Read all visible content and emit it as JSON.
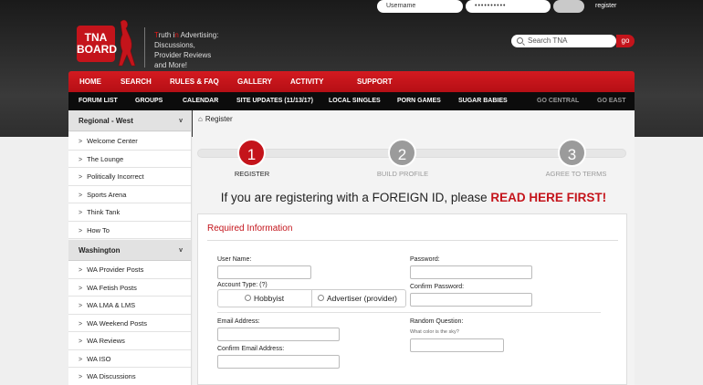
{
  "login": {
    "username_placeholder": "Username",
    "password_value": "••••••••••",
    "register_label": "register"
  },
  "logo": {
    "line1": "TNA",
    "line2": "BOARD"
  },
  "tagline": {
    "t1": "T",
    "t2": "ruth i",
    "t3": "n",
    "t4": " A",
    "t5": "dvertising:",
    "line2": "Discussions,",
    "line3": "Provider Reviews",
    "line4": "and More!"
  },
  "search": {
    "placeholder": "Search TNA",
    "go_label": "go"
  },
  "main_nav": [
    "HOME",
    "SEARCH",
    "RULES & FAQ",
    "GALLERY",
    "ACTIVITY",
    "SUPPORT"
  ],
  "sub_nav": [
    "FORUM LIST",
    "GROUPS",
    "CALENDAR",
    "SITE UPDATES (11/13/17)",
    "LOCAL SINGLES",
    "PORN GAMES",
    "SUGAR BABIES",
    "GO CENTRAL",
    "GO EAST"
  ],
  "sidebar": {
    "section1": {
      "title": "Regional - West",
      "items": [
        "Welcome Center",
        "The Lounge",
        "Politically Incorrect",
        "Sports Arena",
        "Think Tank",
        "How To"
      ]
    },
    "section2": {
      "title": "Washington",
      "items": [
        "WA Provider Posts",
        "WA Fetish Posts",
        "WA LMA & LMS",
        "WA Weekend Posts",
        "WA Reviews",
        "WA ISO",
        "WA Discussions"
      ]
    }
  },
  "breadcrumb": "Register",
  "steps": [
    {
      "num": "1",
      "label": "REGISTER"
    },
    {
      "num": "2",
      "label": "BUILD PROFILE"
    },
    {
      "num": "3",
      "label": "AGREE TO TERMS"
    }
  ],
  "foreign_notice": {
    "text": "If you are registering with a FOREIGN ID, please ",
    "link": "READ HERE FIRST!"
  },
  "form": {
    "heading": "Required Information",
    "username_label": "User Name:",
    "password_label": "Password:",
    "account_type_label": "Account Type: (?)",
    "confirm_password_label": "Confirm Password:",
    "hobbyist_label": "Hobbyist",
    "advertiser_label": "Advertiser (provider)",
    "email_label": "Email Address:",
    "confirm_email_label": "Confirm Email Address:",
    "random_question_label": "Random Question:",
    "random_question_text": "What color is the sky?"
  },
  "colors": {
    "brand_red": "#c4141b",
    "nav_black": "#0c0c0c"
  }
}
